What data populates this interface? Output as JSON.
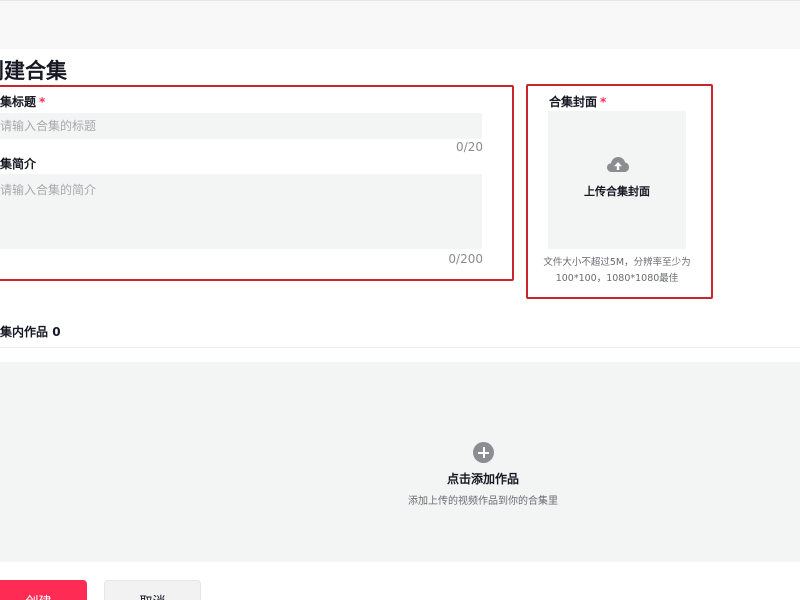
{
  "page": {
    "title": "创建合集"
  },
  "form": {
    "title_field": {
      "label": "合集标题",
      "required_mark": "*",
      "placeholder": "请输入合集的标题",
      "value": "",
      "counter": "0/20"
    },
    "intro_field": {
      "label": "合集简介",
      "placeholder": "请输入合集的简介",
      "value": "",
      "counter": "0/200"
    },
    "cover": {
      "label": "合集封面",
      "required_mark": "*",
      "upload_text": "上传合集封面",
      "icon": "cloud-upload-icon",
      "hint": "文件大小不超过5M，分辨率至少为100*100，1080*1080最佳"
    }
  },
  "works": {
    "label": "合集内作品",
    "count": "0",
    "add_icon": "plus-circle-icon",
    "add_title": "点击添加作品",
    "add_subtitle": "添加上传的视频作品到你的合集里"
  },
  "actions": {
    "create_label": "创建",
    "cancel_label": "取消"
  },
  "colors": {
    "accent": "#fe2c55",
    "highlight_outline": "#c8262b",
    "input_bg": "#f3f4f4"
  }
}
